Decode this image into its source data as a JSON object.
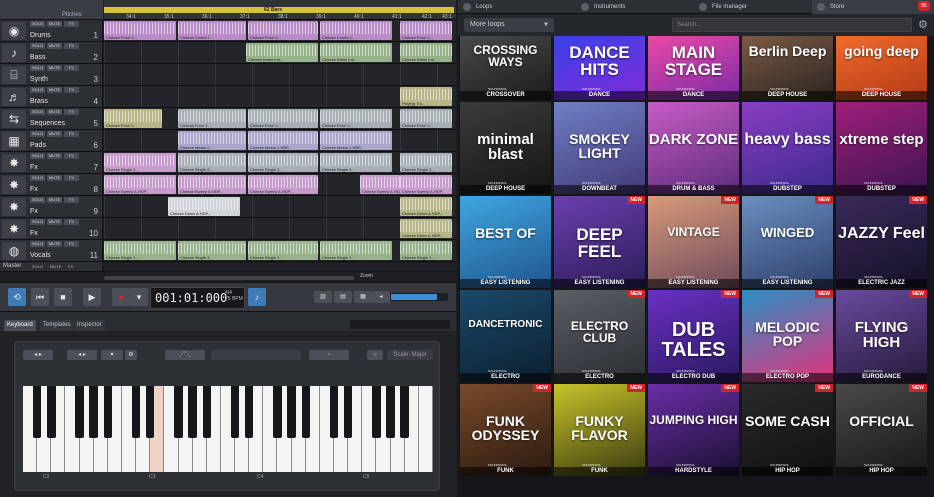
{
  "arranger": {
    "header": "Pitches",
    "ruler_title": "62 Bars",
    "ticks": [
      "34:1",
      "35:1",
      "36:1",
      "37:1",
      "38:1",
      "39:1",
      "40:1",
      "41:1",
      "42:1",
      "43:1"
    ],
    "buttons": {
      "solo": "SOLO",
      "mute": "MUTE",
      "fx": "FX"
    },
    "tracks": [
      {
        "name": "Drums",
        "num": "1",
        "icon": "drums-icon"
      },
      {
        "name": "Bass",
        "num": "2",
        "icon": "bass-icon"
      },
      {
        "name": "Synth",
        "num": "3",
        "icon": "keys-icon"
      },
      {
        "name": "Brass",
        "num": "4",
        "icon": "brass-icon"
      },
      {
        "name": "Sequences",
        "num": "5",
        "icon": "sequence-icon"
      },
      {
        "name": "Pads",
        "num": "6",
        "icon": "pads-icon"
      },
      {
        "name": "Fx",
        "num": "7",
        "icon": "fx-icon"
      },
      {
        "name": "Fx",
        "num": "8",
        "icon": "fx-icon"
      },
      {
        "name": "Fx",
        "num": "9",
        "icon": "fx-icon"
      },
      {
        "name": "Fx",
        "num": "10",
        "icon": "fx-icon"
      },
      {
        "name": "Vocals",
        "num": "11",
        "icon": "vocals-icon"
      }
    ],
    "clip_labels": {
      "drums": "Cheese Form 2...",
      "drums2": "Cheese Combi 1...",
      "bass": "Cheese Brass Intr...",
      "brass": "Playing Tru...",
      "seq": "Cheese Form 2...",
      "pads": "Cheese Mesar 2...",
      "pads2": "Cheese Mesar 2.HDP...",
      "fx7": "Cheese Single 2...",
      "fx8": "Cheese Sweep A.HDP...",
      "fx9": "Cheese Down A.HDP...",
      "vocals": "Cheese Single 1..."
    },
    "master": "Master",
    "master_buttons": [
      "SOLO",
      "MUTE",
      "FX"
    ],
    "zoom_label": "Zoom"
  },
  "transport": {
    "time": "001:01:000",
    "bpm_top": "4/4",
    "bpm_val": "75",
    "bpm_unit": "BPM",
    "volume": 0.82
  },
  "bottom_tabs": [
    "Keyboard",
    "Templates",
    "Inspector"
  ],
  "keyboard": {
    "octaves": [
      "C2",
      "C3",
      "C4",
      "C5"
    ],
    "preset": "Scale: Major",
    "pressed_key": 9
  },
  "right": {
    "tabs": [
      "Loops",
      "Instruments",
      "File manager",
      "Store"
    ],
    "badge": "85",
    "dropdown": "More loops",
    "search_placeholder": "Search...",
    "new_label": "NEW",
    "brand": "SOUNDPOOL",
    "packs": [
      {
        "title": "CROSSING WAYS",
        "genre": "CROSSOVER"
      },
      {
        "title": "DANCE HITS",
        "genre": "DANCE"
      },
      {
        "title": "MAIN STAGE",
        "genre": "DANCE"
      },
      {
        "title": "Berlin Deep",
        "genre": "DEEP HOUSE"
      },
      {
        "title": "going deep",
        "genre": "DEEP HOUSE"
      },
      {
        "title": "minimal blast",
        "genre": "DEEP HOUSE"
      },
      {
        "title": "SMOKEY LIGHT",
        "genre": "DOWNBEAT"
      },
      {
        "title": "DARK ZONE",
        "genre": "DRUM & BASS"
      },
      {
        "title": "heavy bass",
        "genre": "DUBSTEP"
      },
      {
        "title": "xtreme step",
        "genre": "DUBSTEP"
      },
      {
        "title": "BEST OF",
        "genre": "EASY LISTENING"
      },
      {
        "title": "DEEP FEEL",
        "genre": "EASY LISTENING"
      },
      {
        "title": "VINTAGE",
        "genre": "EASY LISTENING"
      },
      {
        "title": "WINGED",
        "genre": "EASY LISTENING"
      },
      {
        "title": "JAZZY Feel",
        "genre": "ELECTRIC JAZZ"
      },
      {
        "title": "DANCETRONIC",
        "genre": "ELECTRO"
      },
      {
        "title": "ELECTRO CLUB",
        "genre": "ELECTRO"
      },
      {
        "title": "DUB TALES",
        "genre": "ELECTRO DUB"
      },
      {
        "title": "MELODIC POP",
        "genre": "ELECTRO POP"
      },
      {
        "title": "FLYING HIGH",
        "genre": "EURODANCE"
      },
      {
        "title": "FUNK ODYSSEY",
        "genre": "FUNK"
      },
      {
        "title": "FUNKY FLAVOR",
        "genre": "FUNK"
      },
      {
        "title": "JUMPING HIGH",
        "genre": "HARDSTYLE"
      },
      {
        "title": "SOME CASH",
        "genre": "HIP HOP"
      },
      {
        "title": "OFFICIAL",
        "genre": "HIP HOP"
      }
    ]
  },
  "colors": {
    "accent": "#3f7bb7",
    "new_badge": "#d3232a",
    "ruler": "#d8c23a"
  }
}
